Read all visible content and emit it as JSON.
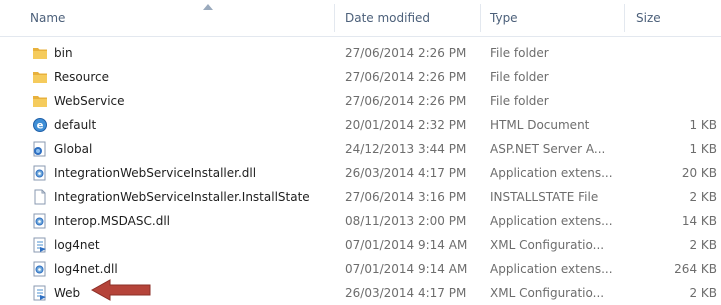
{
  "columns": {
    "name": "Name",
    "date": "Date modified",
    "type": "Type",
    "size": "Size",
    "sort_icon": "sort-ascending-caret"
  },
  "files": [
    {
      "name": "bin",
      "date": "27/06/2014 2:26 PM",
      "type": "File folder",
      "size": "",
      "icon": "folder"
    },
    {
      "name": "Resource",
      "date": "27/06/2014 2:26 PM",
      "type": "File folder",
      "size": "",
      "icon": "folder"
    },
    {
      "name": "WebService",
      "date": "27/06/2014 2:26 PM",
      "type": "File folder",
      "size": "",
      "icon": "folder"
    },
    {
      "name": "default",
      "date": "20/01/2014 2:32 PM",
      "type": "HTML Document",
      "size": "1 KB",
      "icon": "html"
    },
    {
      "name": "Global",
      "date": "24/12/2013 3:44 PM",
      "type": "ASP.NET Server A...",
      "size": "1 KB",
      "icon": "asax"
    },
    {
      "name": "IntegrationWebServiceInstaller.dll",
      "date": "26/03/2014 4:17 PM",
      "type": "Application extens...",
      "size": "20 KB",
      "icon": "dll"
    },
    {
      "name": "IntegrationWebServiceInstaller.InstallState",
      "date": "27/06/2014 3:16 PM",
      "type": "INSTALLSTATE File",
      "size": "2 KB",
      "icon": "blank"
    },
    {
      "name": "Interop.MSDASC.dll",
      "date": "08/11/2013 2:00 PM",
      "type": "Application extens...",
      "size": "14 KB",
      "icon": "dll"
    },
    {
      "name": "log4net",
      "date": "07/01/2014 9:14 AM",
      "type": "XML Configuratio...",
      "size": "2 KB",
      "icon": "config"
    },
    {
      "name": "log4net.dll",
      "date": "07/01/2014 9:14 AM",
      "type": "Application extens...",
      "size": "264 KB",
      "icon": "dll"
    },
    {
      "name": "Web",
      "date": "26/03/2014 4:17 PM",
      "type": "XML Configuratio...",
      "size": "2 KB",
      "icon": "config"
    }
  ],
  "annotation": {
    "icon": "red-arrow-pointing-left",
    "color": "#b5443a",
    "target": "Web"
  },
  "colors": {
    "header_text": "#4c607a",
    "folder": "#e8b13c",
    "detail_text": "#6d6d6d"
  }
}
